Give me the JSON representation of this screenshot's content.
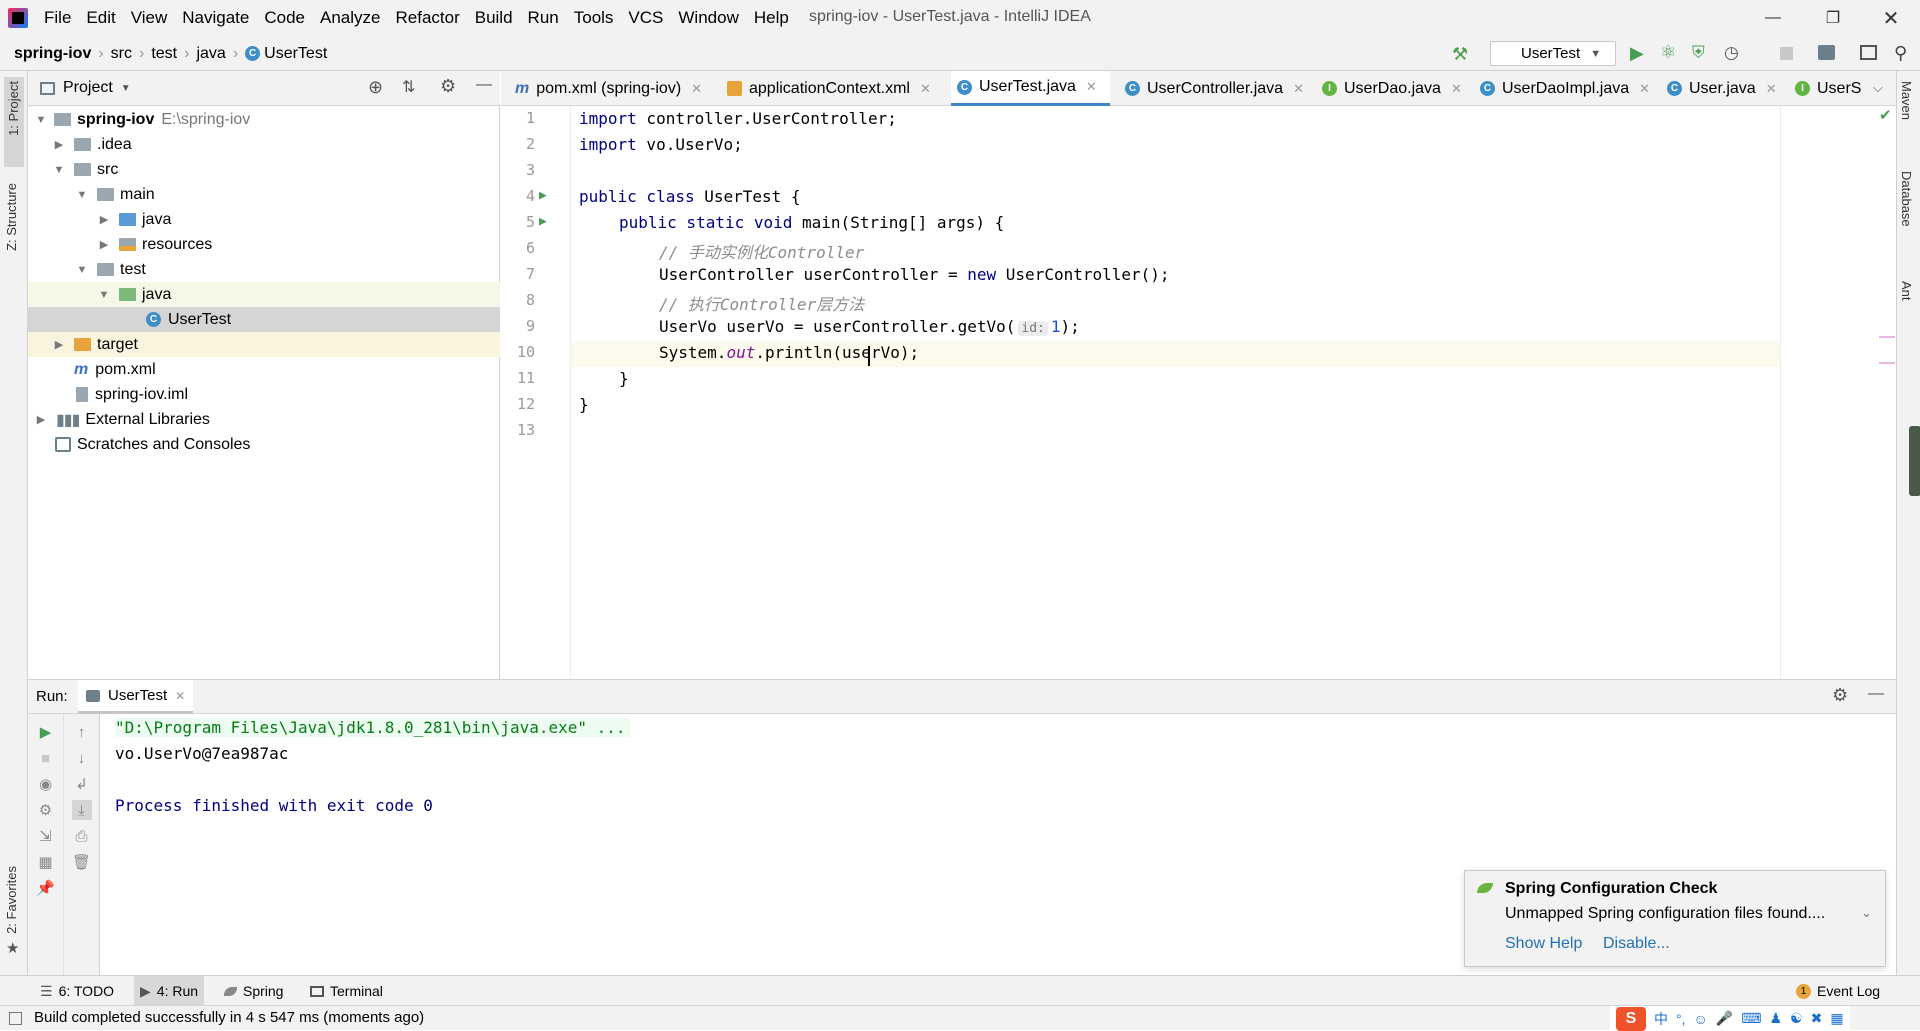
{
  "app": {
    "window_title": "spring-iov - UserTest.java - IntelliJ IDEA",
    "menu": [
      "File",
      "Edit",
      "View",
      "Navigate",
      "Code",
      "Analyze",
      "Refactor",
      "Build",
      "Run",
      "Tools",
      "VCS",
      "Window",
      "Help"
    ]
  },
  "breadcrumb": [
    "spring-iov",
    "src",
    "test",
    "java",
    "UserTest"
  ],
  "run_config": "UserTest",
  "side_labels": {
    "project": "1: Project",
    "structure": "Z: Structure",
    "favorites": "2: Favorites",
    "maven": "Maven",
    "database": "Database",
    "ant": "Ant"
  },
  "project": {
    "title": "Project",
    "root_name": "spring-iov",
    "root_path": "E:\\spring-iov",
    "items": [
      ".idea",
      "src",
      "main",
      "java",
      "resources",
      "test",
      "java",
      "UserTest",
      "target",
      "pom.xml",
      "spring-iov.iml",
      "External Libraries",
      "Scratches and Consoles"
    ]
  },
  "tabs": [
    "pom.xml (spring-iov)",
    "applicationContext.xml",
    "UserTest.java",
    "UserController.java",
    "UserDao.java",
    "UserDaoImpl.java",
    "User.java",
    "UserS"
  ],
  "code": {
    "line_numbers": [
      "1",
      "2",
      "3",
      "4",
      "5",
      "6",
      "7",
      "8",
      "9",
      "10",
      "11",
      "12",
      "13"
    ],
    "l1_kw": "import",
    "l1_rest": " controller.UserController;",
    "l2_kw": "import",
    "l2_rest": " vo.UserVo;",
    "l4_kw": "public class",
    "l4_rest": " UserTest {",
    "l5_kw": "public static void",
    "l5_rest": " main(String[] args) {",
    "l6": "// 手动实例化Controller",
    "l7_a": "UserController userController = ",
    "l7_kw": "new",
    "l7_b": " UserController();",
    "l8": "// 执行Controller层方法",
    "l9_a": "UserVo userVo = userController.getVo(",
    "l9_hint": "id:",
    "l9_num": "1",
    "l9_b": ");",
    "l10_a": "System.",
    "l10_fld": "out",
    "l10_b": ".println(userVo);",
    "l11": "}",
    "l12": "}"
  },
  "run": {
    "label": "Run:",
    "tab": "UserTest",
    "console": {
      "cmd": "\"D:\\Program Files\\Java\\jdk1.8.0_281\\bin\\java.exe\" ...",
      "out": "vo.UserVo@7ea987ac",
      "exit": "Process finished with exit code 0"
    }
  },
  "notification": {
    "title": "Spring Configuration Check",
    "body": "Unmapped Spring configuration files found....",
    "show_help": "Show Help",
    "disable": "Disable..."
  },
  "toolwindows": {
    "todo": "6: TODO",
    "run": "4: Run",
    "spring": "Spring",
    "terminal": "Terminal",
    "event_log": "Event Log",
    "event_count": "1"
  },
  "status": "Build completed successfully in 4 s 547 ms (moments ago)",
  "colors": {
    "accent": "#4083c9",
    "run_green": "#499c54",
    "selection": "#d5d5d5",
    "string_green": "#067d17"
  }
}
